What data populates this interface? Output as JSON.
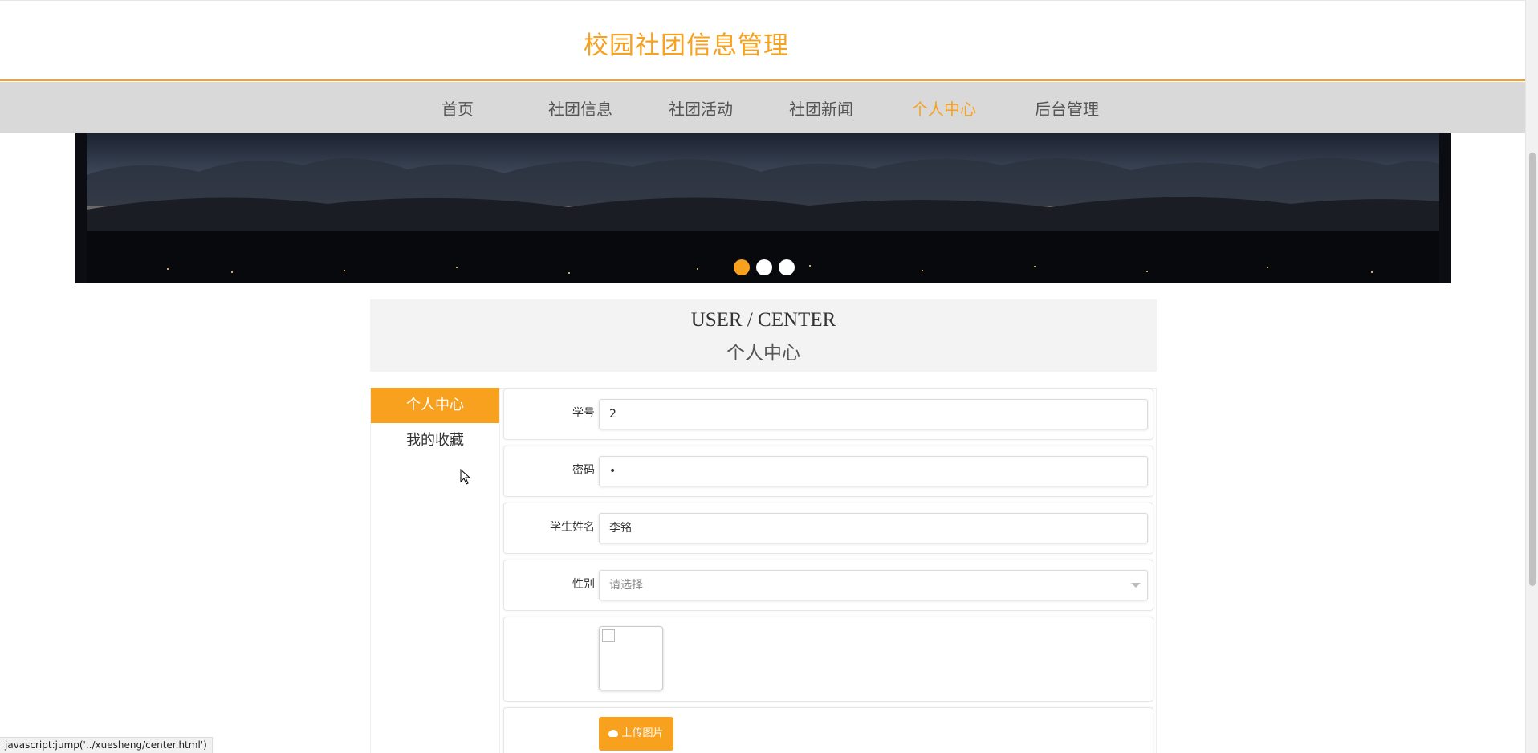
{
  "header": {
    "site_title": "校园社团信息管理"
  },
  "nav": {
    "items": [
      {
        "label": "首页"
      },
      {
        "label": "社团信息"
      },
      {
        "label": "社团活动"
      },
      {
        "label": "社团新闻"
      },
      {
        "label": "个人中心"
      },
      {
        "label": "后台管理"
      }
    ],
    "active_index": 4
  },
  "banner": {
    "dot_count": 3,
    "active_dot": 0
  },
  "section": {
    "title_en": "USER / CENTER",
    "title_zh": "个人中心"
  },
  "sidebar": {
    "items": [
      {
        "label": "个人中心"
      },
      {
        "label": "我的收藏"
      }
    ],
    "active_index": 0
  },
  "form": {
    "student_id": {
      "label": "学号",
      "value": "2"
    },
    "password": {
      "label": "密码",
      "value": "•"
    },
    "name": {
      "label": "学生姓名",
      "value": "李铭"
    },
    "gender": {
      "label": "性别",
      "value": "请选择"
    },
    "upload_button": "上传图片"
  },
  "statusbar": {
    "text": "javascript:jump('../xuesheng/center.html')"
  },
  "colors": {
    "accent": "#f7a11f",
    "nav_bg": "#d9d9d9",
    "section_bg": "#f3f3f3"
  }
}
